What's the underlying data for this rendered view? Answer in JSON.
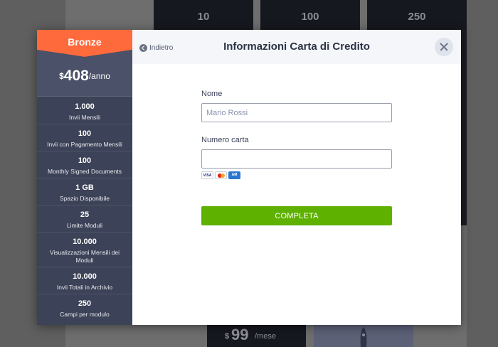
{
  "background": {
    "cards": [
      "10",
      "100",
      "250"
    ],
    "bottom_card": {
      "currency": "$",
      "price": "99",
      "period": "/mese"
    }
  },
  "sidebar": {
    "plan_name": "Bronze",
    "plan_color": "#ff6a3d",
    "price": {
      "currency": "$",
      "amount": "408",
      "period": "/anno"
    },
    "features": [
      {
        "value": "1.000",
        "label": "Invii Mensili"
      },
      {
        "value": "100",
        "label": "Invii con Pagamento Mensili"
      },
      {
        "value": "100",
        "label": "Monthly Signed Documents"
      },
      {
        "value": "1 GB",
        "label": "Spazio Disponibile"
      },
      {
        "value": "25",
        "label": "Limite Moduli"
      },
      {
        "value": "10.000",
        "label": "Visualizzazioni Mensili dei Moduli"
      },
      {
        "value": "10.000",
        "label": "Invii Totali in Archivio"
      },
      {
        "value": "250",
        "label": "Campi per modulo"
      }
    ]
  },
  "header": {
    "back_label": "Indietro",
    "title": "Informazioni Carta di Credito",
    "close_icon": "close-icon"
  },
  "form": {
    "name_label": "Nome",
    "name_placeholder": "Mario Rossi",
    "name_value": "",
    "card_label": "Numero carta",
    "card_placeholder": "",
    "card_value": "",
    "card_brands": [
      "VISA",
      "mastercard",
      "amex"
    ],
    "submit_label": "COMPLETA",
    "submit_color": "#5fb100"
  }
}
